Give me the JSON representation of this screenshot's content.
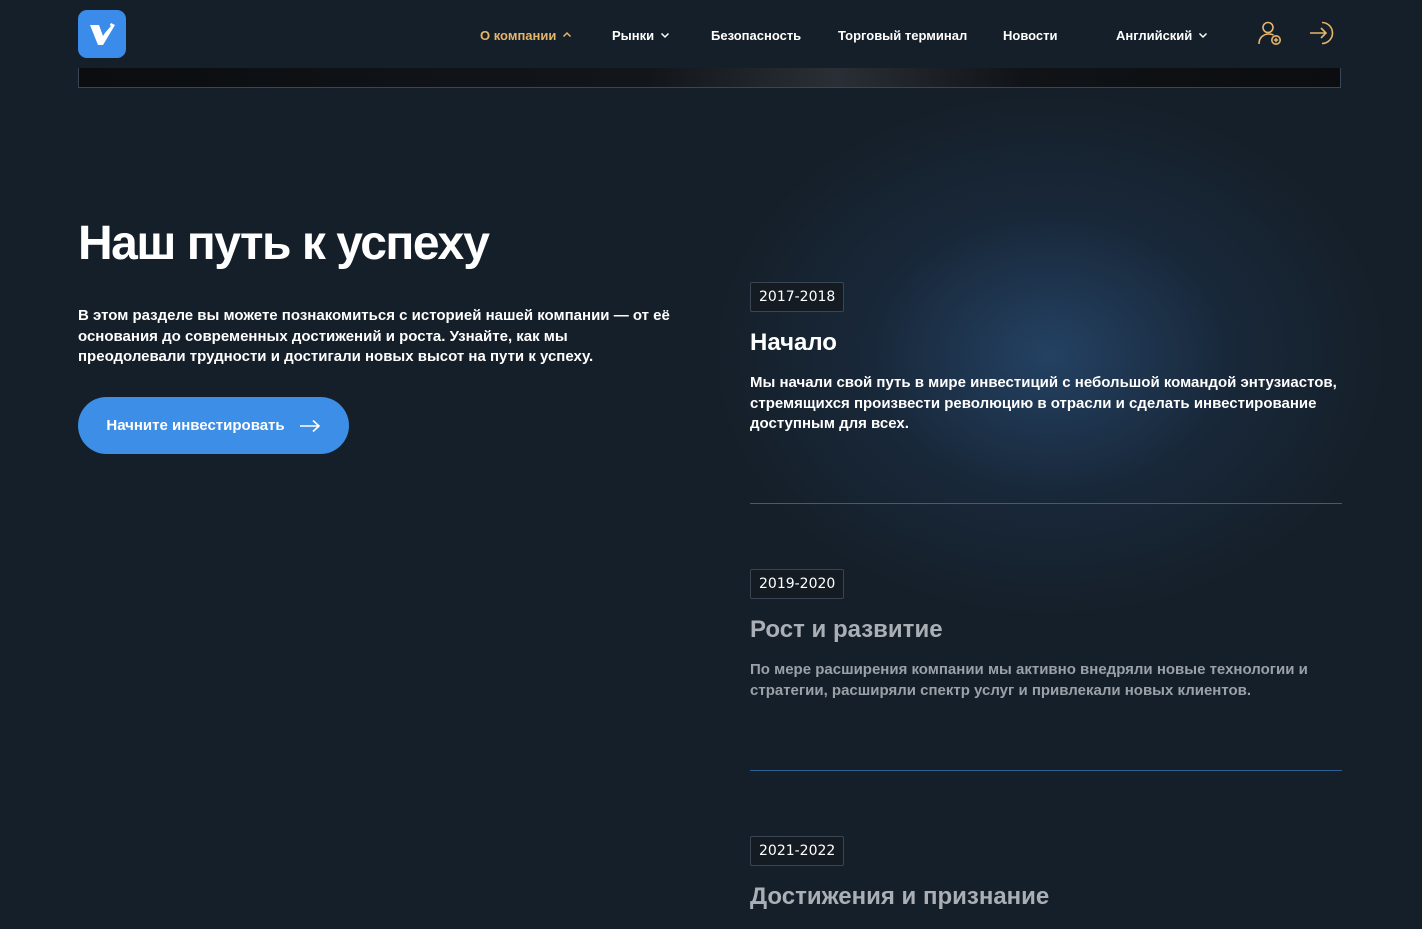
{
  "header": {
    "logo_alt": "logo",
    "nav": [
      {
        "label": "О компании",
        "has_dropdown": true,
        "expanded": true
      },
      {
        "label": "Рынки",
        "has_dropdown": true,
        "expanded": false
      },
      {
        "label": "Безопасность",
        "has_dropdown": false
      },
      {
        "label": "Торговый терминал",
        "has_dropdown": false
      },
      {
        "label": "Новости",
        "has_dropdown": false
      }
    ],
    "language": "Английский",
    "icons": [
      "user-add-icon",
      "login-icon"
    ]
  },
  "hero": {
    "title": "Наш путь к успеху",
    "text": "В этом разделе вы можете познакомиться с историей нашей компании — от её основания до современных достижений и роста. Узнайте, как мы преодолевали трудности и достигали новых высот на пути к успеху.",
    "cta_label": "Начните инвестировать"
  },
  "timeline": [
    {
      "years": "2017-2018",
      "title": "Начало",
      "text": "Мы начали свой путь в мире инвестиций с небольшой командой энтузиастов, стремящихся произвести революцию в отрасли и сделать инвестирование доступным для всех."
    },
    {
      "years": "2019-2020",
      "title": "Рост и развитие",
      "text": "По мере расширения компании мы активно внедряли новые технологии и стратегии, расширяли спектр услуг и привлекали новых клиентов."
    },
    {
      "years": "2021-2022",
      "title": "Достижения и признание",
      "text": ""
    }
  ],
  "colors": {
    "background": "#151f29",
    "accent": "#3d8ee6",
    "active_nav": "#e5b66a",
    "divider": "#2e5f95"
  }
}
